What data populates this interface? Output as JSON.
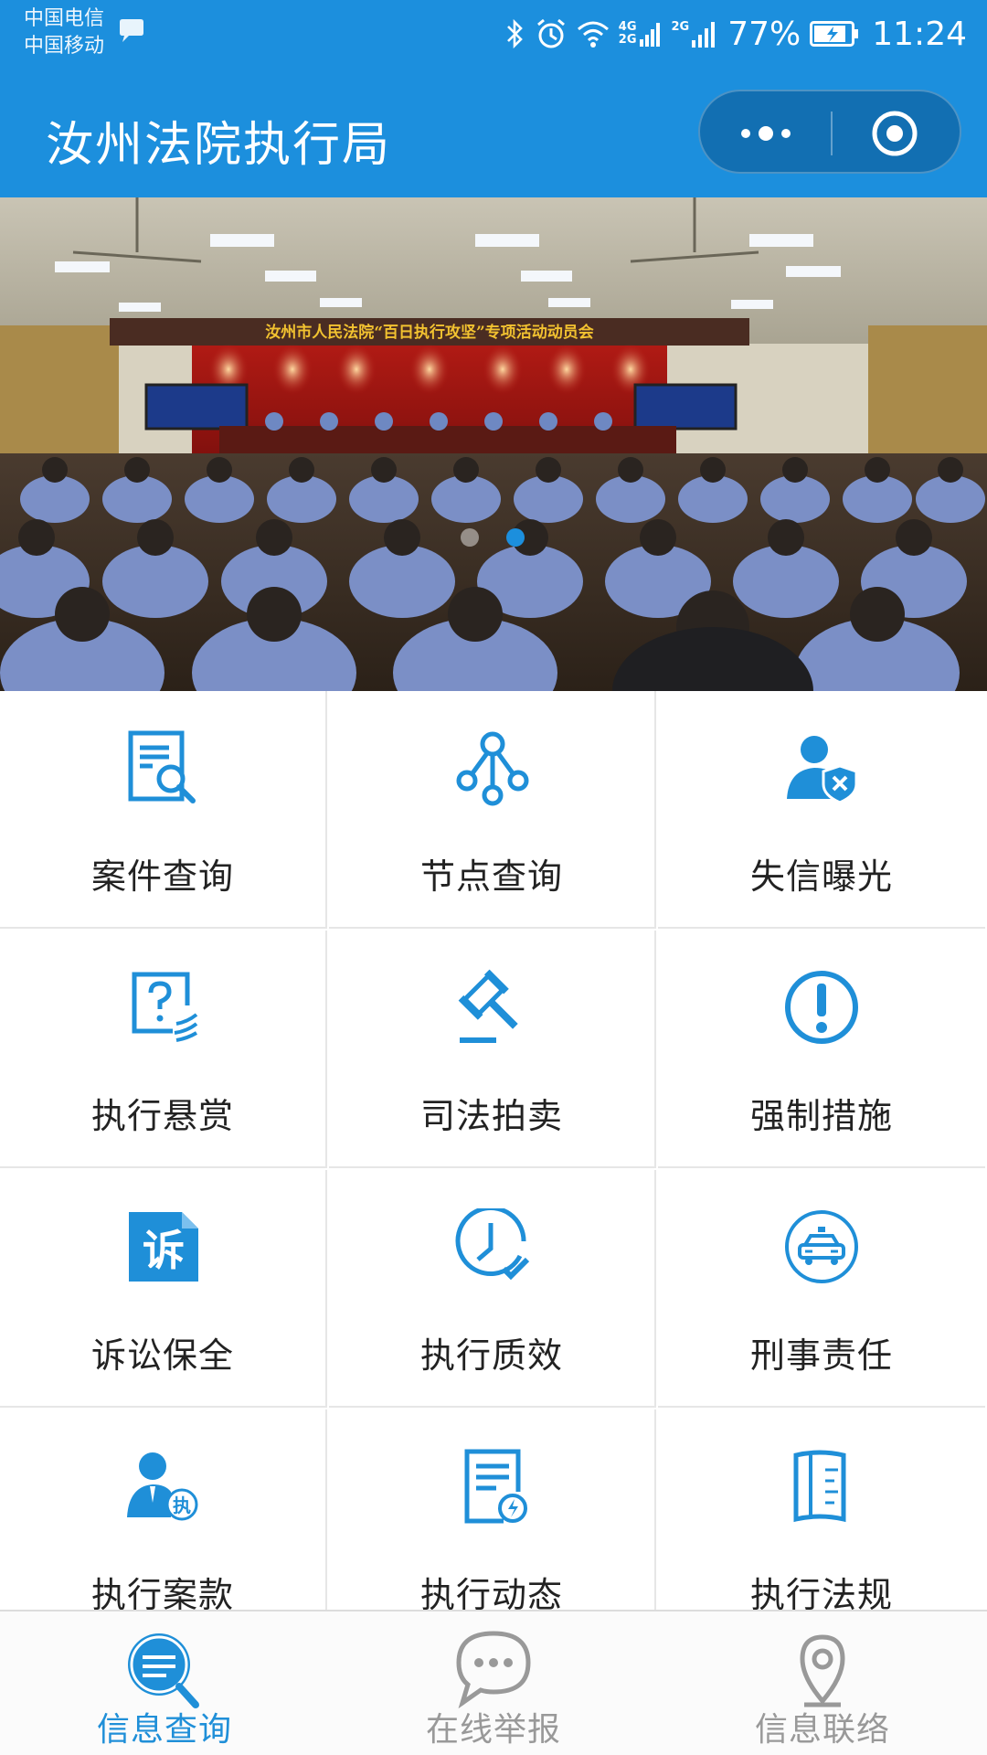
{
  "status_bar": {
    "carrier_1": "中国电信",
    "carrier_2": "中国移动",
    "network_1": "4G",
    "network_1b": "2G",
    "network_2": "2G",
    "battery": "77%",
    "time": "11:24"
  },
  "nav": {
    "title": "汝州法院执行局",
    "more_icon": "more-dots-icon",
    "close_icon": "target-circle-icon"
  },
  "banner": {
    "slogan": "汝州市人民法院“百日执行攻坚”专项活动动员会",
    "active_slide": 2,
    "slide_count": 2
  },
  "menu": {
    "items": [
      {
        "label": "案件查询",
        "icon": "document-search-icon"
      },
      {
        "label": "节点查询",
        "icon": "node-tree-icon"
      },
      {
        "label": "失信曝光",
        "icon": "person-shield-x-icon"
      },
      {
        "label": "执行悬赏",
        "icon": "question-reward-icon"
      },
      {
        "label": "司法拍卖",
        "icon": "gavel-icon"
      },
      {
        "label": "强制措施",
        "icon": "exclamation-circle-icon"
      },
      {
        "label": "诉讼保全",
        "icon": "litigation-badge-icon"
      },
      {
        "label": "执行质效",
        "icon": "clock-check-icon"
      },
      {
        "label": "刑事责任",
        "icon": "police-car-icon"
      },
      {
        "label": "执行案款",
        "icon": "person-payment-icon"
      },
      {
        "label": "执行动态",
        "icon": "document-bolt-icon"
      },
      {
        "label": "执行法规",
        "icon": "rulebook-icon"
      }
    ],
    "badge_char_litigation": "诉",
    "badge_char_execute": "执"
  },
  "tabbar": {
    "tabs": [
      {
        "label": "信息查询",
        "icon": "info-search-icon",
        "active": true
      },
      {
        "label": "在线举报",
        "icon": "chat-bubble-icon",
        "active": false
      },
      {
        "label": "信息联络",
        "icon": "location-pin-icon",
        "active": false
      }
    ]
  },
  "colors": {
    "brand_blue": "#1c8fdd",
    "icon_blue": "#1f8fd8",
    "tab_inactive": "#999999"
  }
}
